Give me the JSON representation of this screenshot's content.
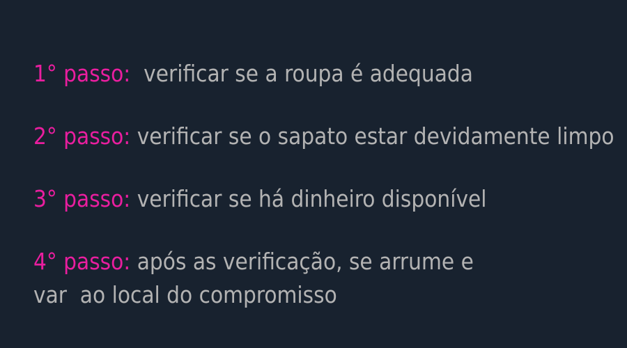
{
  "steps": [
    {
      "label": "1° passo:",
      "text": "  verificar se a roupa é adequada"
    },
    {
      "label": "2° passo:",
      "text": " verificar se o sapato estar devidamente limpo"
    },
    {
      "label": "3° passo:",
      "text": " verificar se há dinheiro disponível"
    },
    {
      "label": "4° passo:",
      "text": " após as verificação, se arrume e\nvar  ao local do compromisso"
    }
  ],
  "colors": {
    "background": "#18222f",
    "label": "#e91e9f",
    "text": "#b3b3b3"
  }
}
